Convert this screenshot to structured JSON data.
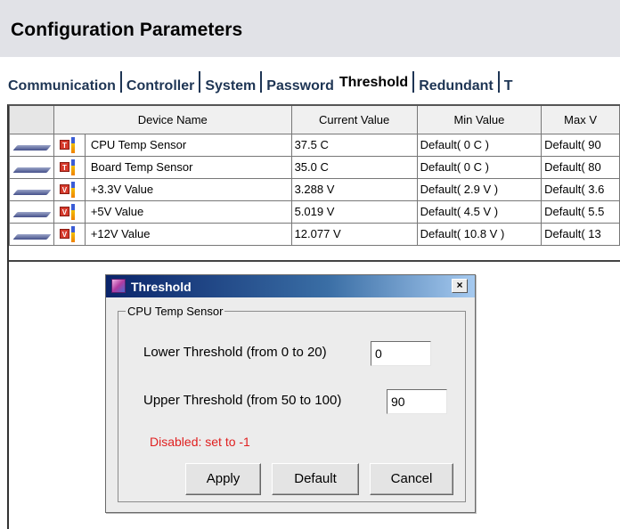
{
  "header": {
    "title": "Configuration Parameters"
  },
  "tabs": [
    {
      "label": "Communication",
      "active": false
    },
    {
      "label": "Controller",
      "active": false
    },
    {
      "label": "System",
      "active": false
    },
    {
      "label": "Password",
      "active": false
    },
    {
      "label": "Threshold",
      "active": true
    },
    {
      "label": "Redundant",
      "active": false
    },
    {
      "label": "T",
      "active": false
    }
  ],
  "table": {
    "columns": [
      "Device Name",
      "Current Value",
      "Min Value",
      "Max V"
    ],
    "rows": [
      {
        "icon": "temperature-icon",
        "badge": "T",
        "name": "CPU Temp Sensor",
        "current": "37.5 C",
        "min": "Default( 0 C )",
        "max": "Default( 90"
      },
      {
        "icon": "temperature-icon",
        "badge": "T",
        "name": "Board Temp Sensor",
        "current": "35.0 C",
        "min": "Default( 0 C )",
        "max": "Default( 80"
      },
      {
        "icon": "voltage-icon",
        "badge": "V",
        "name": "+3.3V Value",
        "current": "3.288 V",
        "min": "Default( 2.9 V )",
        "max": "Default( 3.6"
      },
      {
        "icon": "voltage-icon",
        "badge": "V",
        "name": "+5V Value",
        "current": "5.019 V",
        "min": "Default( 4.5 V )",
        "max": "Default( 5.5"
      },
      {
        "icon": "voltage-icon",
        "badge": "V",
        "name": "+12V Value",
        "current": "12.077 V",
        "min": "Default( 10.8 V )",
        "max": "Default( 13"
      }
    ]
  },
  "dialog": {
    "title": "Threshold",
    "close_glyph": "×",
    "group_label": "CPU Temp Sensor",
    "lower_label": "Lower Threshold  (from 0 to 20)",
    "lower_value": "0",
    "upper_label": "Upper Threshold  (from 50 to 100)",
    "upper_value": "90",
    "hint": "Disabled: set to -1",
    "buttons": {
      "apply": "Apply",
      "default": "Default",
      "cancel": "Cancel"
    }
  },
  "colors": {
    "header_bg": "#e1e2e7",
    "tab_text": "#1e3554",
    "hint_red": "#e02020",
    "titlebar_start": "#0a246a",
    "titlebar_end": "#a6caf0",
    "temp_badge": "#d63a2c"
  }
}
